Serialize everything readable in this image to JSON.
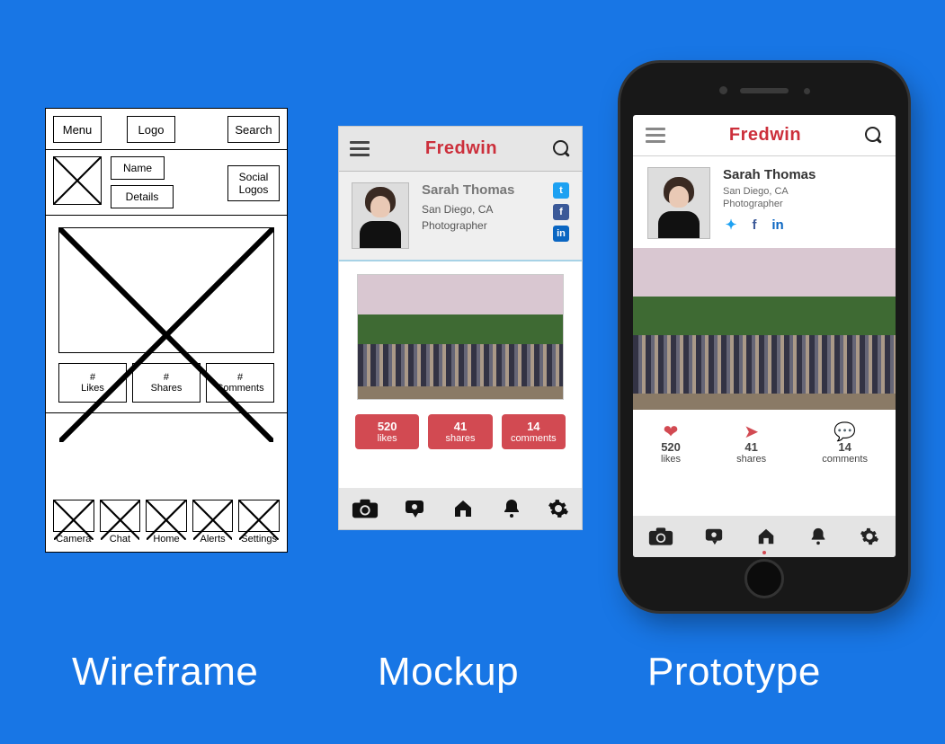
{
  "captions": {
    "wireframe": "Wireframe",
    "mockup": "Mockup",
    "prototype": "Prototype"
  },
  "wireframe": {
    "top": {
      "menu": "Menu",
      "logo": "Logo",
      "search": "Search"
    },
    "profile": {
      "name": "Name",
      "details": "Details",
      "social": "Social\nLogos"
    },
    "stats": {
      "likes": "#\nLikes",
      "shares": "#\nShares",
      "comments": "#\nComments"
    },
    "nav": [
      "Camera",
      "Chat",
      "Home",
      "Alerts",
      "Settings"
    ]
  },
  "mockup": {
    "brand": "Fredwin",
    "profile": {
      "name": "Sarah Thomas",
      "location": "San Diego, CA",
      "role": "Photographer"
    },
    "stats": {
      "likes": {
        "count": "520",
        "label": "likes"
      },
      "shares": {
        "count": "41",
        "label": "shares"
      },
      "comments": {
        "count": "14",
        "label": "comments"
      }
    }
  },
  "prototype": {
    "brand": "Fredwin",
    "profile": {
      "name": "Sarah Thomas",
      "location": "San Diego, CA",
      "role": "Photographer"
    },
    "stats": {
      "likes": {
        "count": "520",
        "label": "likes"
      },
      "shares": {
        "count": "41",
        "label": "shares"
      },
      "comments": {
        "count": "14",
        "label": "comments"
      }
    }
  }
}
